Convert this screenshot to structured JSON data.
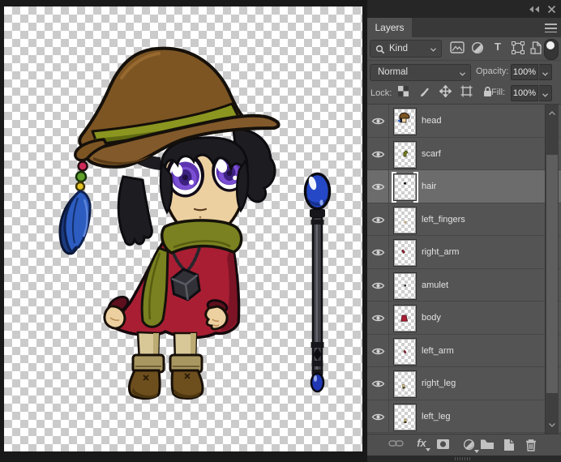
{
  "titlebar": {
    "collapse_icon": "collapse-panels-double-chevron",
    "close_icon": "close-x"
  },
  "panel": {
    "tab_label": "Layers",
    "panel_menu_icon": "hamburger-menu",
    "filter": {
      "label": "Kind",
      "search_icon": "magnifier",
      "type_icons": [
        "pixel-layer-filter",
        "adjustment-layer-filter",
        "type-layer-filter",
        "shape-layer-filter",
        "smart-object-filter"
      ],
      "toggle_icon": "layer-filter-toggle"
    },
    "blend": {
      "mode": "Normal",
      "opacity_label": "Opacity:",
      "opacity_value": "100%"
    },
    "lock": {
      "label": "Lock:",
      "icons": [
        "lock-transparent-pixels",
        "lock-image-pixels",
        "lock-position",
        "lock-artboard",
        "lock-all"
      ],
      "fill_label": "Fill:",
      "fill_value": "100%"
    },
    "layers": [
      {
        "name": "head",
        "visible": true,
        "selected": false
      },
      {
        "name": "scarf",
        "visible": true,
        "selected": false
      },
      {
        "name": "hair",
        "visible": true,
        "selected": true
      },
      {
        "name": "left_fingers",
        "visible": true,
        "selected": false
      },
      {
        "name": "right_arm",
        "visible": true,
        "selected": false
      },
      {
        "name": "amulet",
        "visible": true,
        "selected": false
      },
      {
        "name": "body",
        "visible": true,
        "selected": false
      },
      {
        "name": "left_arm",
        "visible": true,
        "selected": false
      },
      {
        "name": "right_leg",
        "visible": true,
        "selected": false
      },
      {
        "name": "left_leg",
        "visible": true,
        "selected": false
      }
    ],
    "footer_icons": [
      "link-layers",
      "layer-style-fx",
      "add-layer-mask",
      "new-adjustment-layer",
      "new-group-folder",
      "new-layer",
      "delete-layer-trash"
    ]
  },
  "canvas": {
    "description": "chibi witch character: brown floppy hat with olive band, black hair, large purple eyes, olive scarf, red dress with dark cube amulet, beige legs, brown boots, blue feather beads on hat, and a separate staff with blue orb",
    "artwork_colors": {
      "hat_brown": "#7d5523",
      "band_olive": "#8a961f",
      "hair_black": "#1d1c20",
      "skin_tan": "#ecd0a0",
      "eye_purple": "#7b4fd4",
      "scarf_olive": "#7a8120",
      "dress_red": "#a91e33",
      "boot_brown": "#6d4e1d",
      "sock_beige": "#d8c898",
      "feather_blue": "#2c5cc0",
      "orb_blue": "#2b50d0",
      "bead_pink": "#ce2a58",
      "bead_green": "#61a02a",
      "bead_yellow": "#e2c31f",
      "checker_gray": "#cbcbcb"
    }
  }
}
